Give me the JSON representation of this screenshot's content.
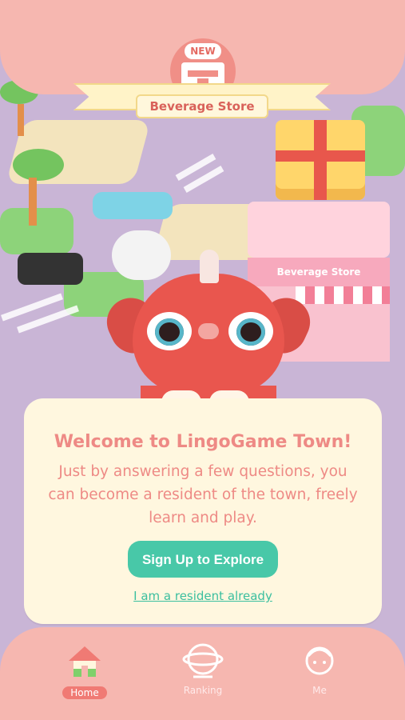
{
  "banner": {
    "badge": "NEW",
    "store_name": "Beverage Store"
  },
  "storefront_sign": "Beverage Store",
  "welcome": {
    "title": "Welcome to LingoGame Town!",
    "body": "Just by answering a few questions, you can become a resident of the town, freely learn and play.",
    "signup_label": "Sign Up to Explore",
    "resident_link": "I am a resident already"
  },
  "nav": {
    "items": [
      {
        "label": "Home",
        "icon": "house-icon",
        "active": true
      },
      {
        "label": "Ranking",
        "icon": "ranking-globe-icon",
        "active": false
      },
      {
        "label": "Me",
        "icon": "profile-icon",
        "active": false
      }
    ]
  },
  "colors": {
    "accent_pink": "#f6b7b0",
    "card_bg": "#fff7df",
    "title_text": "#ee8a85",
    "button_green": "#48c8a8"
  }
}
